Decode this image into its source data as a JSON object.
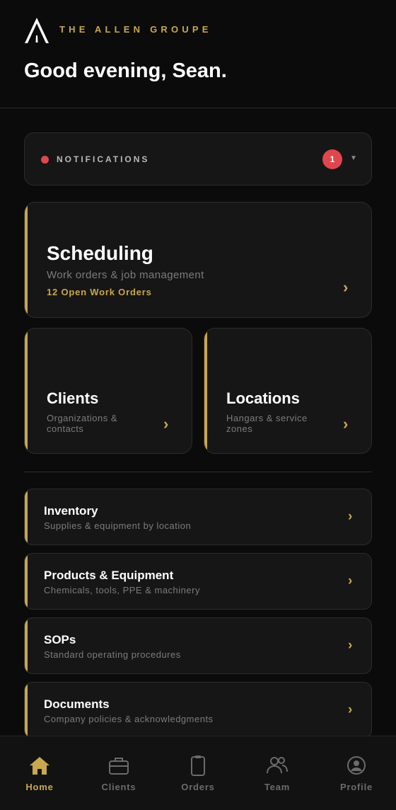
{
  "header": {
    "brand": "THE ALLEN GROUPE",
    "greeting": "Good evening, Sean."
  },
  "notifications": {
    "label": "NOTIFICATIONS",
    "count": "1",
    "caret": "▼"
  },
  "cards": {
    "scheduling": {
      "title": "Scheduling",
      "subtitle": "Work orders & job management",
      "meta": "12 Open Work Orders",
      "chevron": "›"
    },
    "clients": {
      "title": "Clients",
      "subtitle": "Organizations & contacts",
      "chevron": "›"
    },
    "locations": {
      "title": "Locations",
      "subtitle": "Hangars & service zones",
      "chevron": "›"
    }
  },
  "list": [
    {
      "title": "Inventory",
      "subtitle": "Supplies & equipment by location",
      "chevron": "›"
    },
    {
      "title": "Products & Equipment",
      "subtitle": "Chemicals, tools, PPE & machinery",
      "chevron": "›"
    },
    {
      "title": "SOPs",
      "subtitle": "Standard operating procedures",
      "chevron": "›"
    },
    {
      "title": "Documents",
      "subtitle": "Company policies & acknowledgments",
      "chevron": "›"
    }
  ],
  "tabs": [
    {
      "label": "Home",
      "icon": "home-icon",
      "active": true
    },
    {
      "label": "Clients",
      "icon": "briefcase-icon",
      "active": false
    },
    {
      "label": "Orders",
      "icon": "clipboard-icon",
      "active": false
    },
    {
      "label": "Team",
      "icon": "team-icon",
      "active": false
    },
    {
      "label": "Profile",
      "icon": "profile-icon",
      "active": false
    }
  ],
  "colors": {
    "accent": "#c9a74e",
    "badge": "#e0474c",
    "background": "#0b0b0b",
    "card": "#161616"
  }
}
